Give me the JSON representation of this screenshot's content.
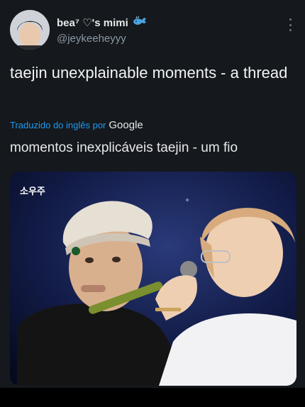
{
  "tweet": {
    "display_name": "bea⁷ ♡'s mimi",
    "display_name_emoji": "whale-emoji",
    "handle": "@jeykeeheyyy",
    "text": "taejin unexplainable moments - a thread",
    "translated_by_label": "Traduzido do inglês por",
    "translator_brand": "Google",
    "translation": "momentos inexplicáveis taejin - um fio",
    "media_watermark": "소우주"
  },
  "colors": {
    "background": "#15181c",
    "link_blue": "#1d9bf0",
    "secondary_text": "#8b98a5"
  },
  "icons": [
    "more-options-icon",
    "whale-emoji-icon"
  ]
}
